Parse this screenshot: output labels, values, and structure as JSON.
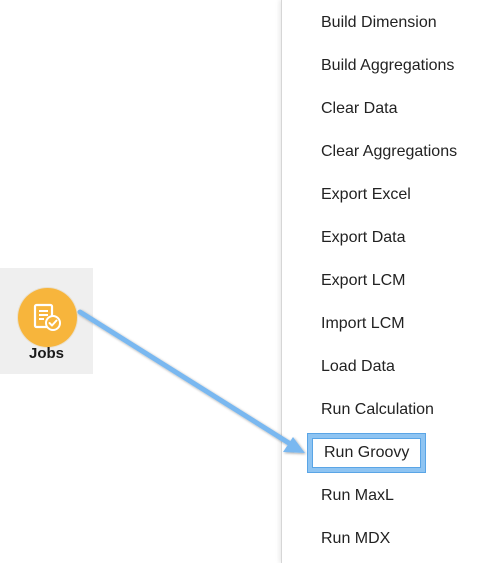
{
  "jobs_tile": {
    "label": "Jobs",
    "icon": "jobs-clipboard-check-icon",
    "icon_color": "#f7b53c"
  },
  "menu": {
    "items": [
      {
        "label": "Build Dimension"
      },
      {
        "label": "Build Aggregations"
      },
      {
        "label": "Clear Data"
      },
      {
        "label": "Clear Aggregations"
      },
      {
        "label": "Export Excel"
      },
      {
        "label": "Export Data"
      },
      {
        "label": "Export LCM"
      },
      {
        "label": "Import LCM"
      },
      {
        "label": "Load Data"
      },
      {
        "label": "Run Calculation"
      },
      {
        "label": "Run Groovy",
        "highlighted": true
      },
      {
        "label": "Run MaxL"
      },
      {
        "label": "Run MDX"
      }
    ],
    "highlight_color": "#8ec4f2"
  },
  "annotation": {
    "arrow_color": "#7ab8f0"
  }
}
